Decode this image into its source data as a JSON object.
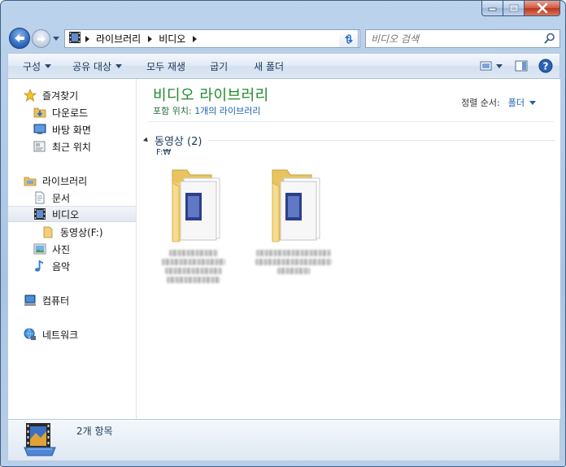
{
  "address": {
    "crumbs": [
      "라이브러리",
      "비디오"
    ]
  },
  "search": {
    "placeholder": "비디오 검색"
  },
  "toolbar": {
    "organize": "구성",
    "share": "공유 대상",
    "play_all": "모두 재생",
    "burn": "굽기",
    "new_folder": "새 폴더"
  },
  "sidebar": {
    "favorites": "즐겨찾기",
    "downloads": "다운로드",
    "desktop": "바탕 화면",
    "recent": "최근 위치",
    "libraries": "라이브러리",
    "documents": "문서",
    "videos": "비디오",
    "videos_sub": "동영상(F:)",
    "pictures": "사진",
    "music": "음악",
    "computer": "컴퓨터",
    "network": "네트워크"
  },
  "main": {
    "title": "비디오 라이브러리",
    "includes_label": "포함 위치:",
    "includes_link": "1개의 라이브러리",
    "sort_label": "정렬 순서:",
    "sort_value": "폴더",
    "group_title": "동영상 (2)",
    "group_path": "F:₩"
  },
  "status": {
    "count": "2개 항목"
  },
  "colors": {
    "title_green": "#1e8a2c",
    "link_blue": "#1f5fb3"
  }
}
